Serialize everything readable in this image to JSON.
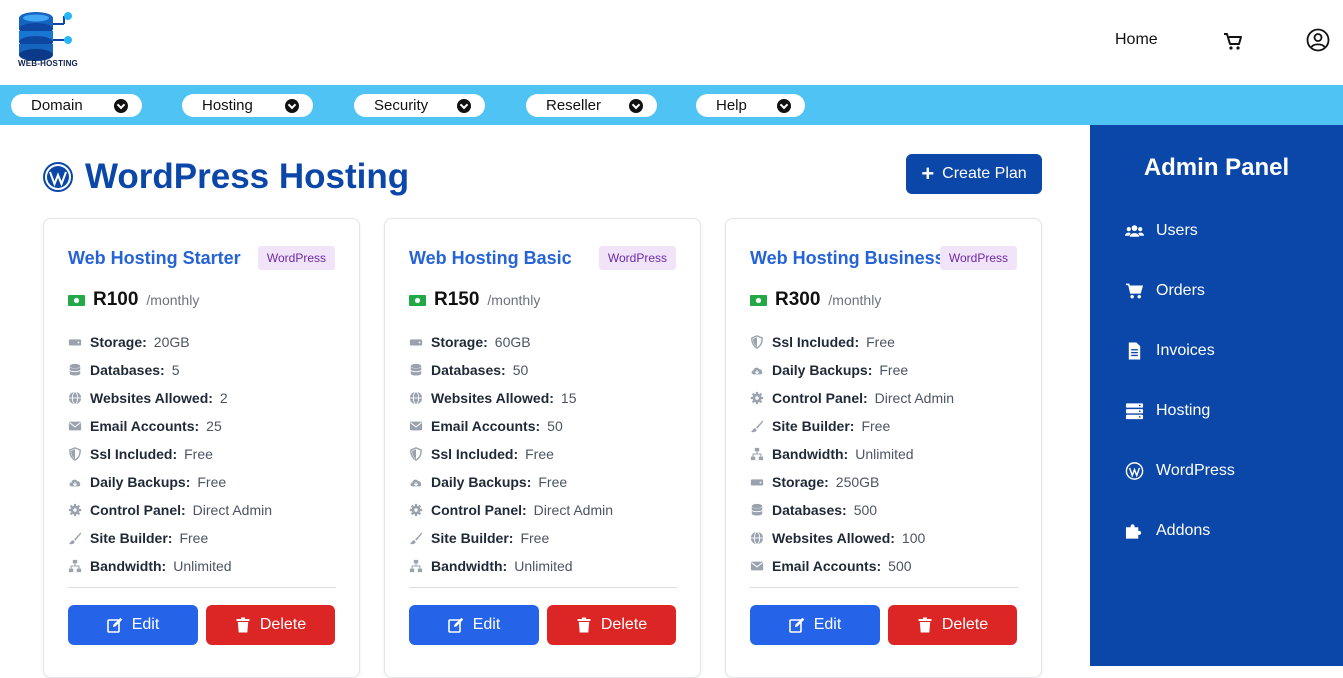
{
  "header": {
    "logo_text": "WEB-HOSTING",
    "home_label": "Home",
    "cart_icon": "cart-icon",
    "user_icon": "user-circle-icon"
  },
  "menu": [
    {
      "label": "Domain"
    },
    {
      "label": "Hosting"
    },
    {
      "label": "Security"
    },
    {
      "label": "Reseller"
    },
    {
      "label": "Help"
    }
  ],
  "main": {
    "title": "WordPress Hosting",
    "create_label": "Create Plan"
  },
  "cards": [
    {
      "title": "Web Hosting Starter",
      "badge": "WordPress",
      "price": "R100",
      "period": "/monthly",
      "features": [
        {
          "icon": "storage",
          "key": "Storage:",
          "value": "20GB"
        },
        {
          "icon": "database",
          "key": "Databases:",
          "value": "5"
        },
        {
          "icon": "globe",
          "key": "Websites Allowed:",
          "value": "2"
        },
        {
          "icon": "mail",
          "key": "Email Accounts:",
          "value": "25"
        },
        {
          "icon": "shield",
          "key": "Ssl Included:",
          "value": "Free"
        },
        {
          "icon": "cloud",
          "key": "Daily Backups:",
          "value": "Free"
        },
        {
          "icon": "gear",
          "key": "Control Panel:",
          "value": "Direct Admin"
        },
        {
          "icon": "brush",
          "key": "Site Builder:",
          "value": "Free"
        },
        {
          "icon": "network",
          "key": "Bandwidth:",
          "value": "Unlimited"
        }
      ],
      "edit_label": "Edit",
      "delete_label": "Delete"
    },
    {
      "title": "Web Hosting Basic",
      "badge": "WordPress",
      "price": "R150",
      "period": "/monthly",
      "features": [
        {
          "icon": "storage",
          "key": "Storage:",
          "value": "60GB"
        },
        {
          "icon": "database",
          "key": "Databases:",
          "value": "50"
        },
        {
          "icon": "globe",
          "key": "Websites Allowed:",
          "value": "15"
        },
        {
          "icon": "mail",
          "key": "Email Accounts:",
          "value": "50"
        },
        {
          "icon": "shield",
          "key": "Ssl Included:",
          "value": "Free"
        },
        {
          "icon": "cloud",
          "key": "Daily Backups:",
          "value": "Free"
        },
        {
          "icon": "gear",
          "key": "Control Panel:",
          "value": "Direct Admin"
        },
        {
          "icon": "brush",
          "key": "Site Builder:",
          "value": "Free"
        },
        {
          "icon": "network",
          "key": "Bandwidth:",
          "value": "Unlimited"
        }
      ],
      "edit_label": "Edit",
      "delete_label": "Delete"
    },
    {
      "title": "Web Hosting Business",
      "badge": "WordPress",
      "price": "R300",
      "period": "/monthly",
      "features": [
        {
          "icon": "shield",
          "key": "Ssl Included:",
          "value": "Free"
        },
        {
          "icon": "cloud",
          "key": "Daily Backups:",
          "value": "Free"
        },
        {
          "icon": "gear",
          "key": "Control Panel:",
          "value": "Direct Admin"
        },
        {
          "icon": "brush",
          "key": "Site Builder:",
          "value": "Free"
        },
        {
          "icon": "network",
          "key": "Bandwidth:",
          "value": "Unlimited"
        },
        {
          "icon": "storage",
          "key": "Storage:",
          "value": "250GB"
        },
        {
          "icon": "database",
          "key": "Databases:",
          "value": "500"
        },
        {
          "icon": "globe",
          "key": "Websites Allowed:",
          "value": "100"
        },
        {
          "icon": "mail",
          "key": "Email Accounts:",
          "value": "500"
        }
      ],
      "edit_label": "Edit",
      "delete_label": "Delete"
    }
  ],
  "sidebar": {
    "title": "Admin Panel",
    "items": [
      {
        "icon": "users",
        "label": "Users"
      },
      {
        "icon": "cart",
        "label": "Orders"
      },
      {
        "icon": "invoice",
        "label": "Invoices"
      },
      {
        "icon": "server",
        "label": "Hosting"
      },
      {
        "icon": "wordpress",
        "label": "WordPress"
      },
      {
        "icon": "puzzle",
        "label": "Addons"
      }
    ]
  },
  "colors": {
    "brand": "#0b47a8",
    "menubar": "#4fc3f3",
    "edit": "#2563e8",
    "delete": "#dc2626",
    "badge_bg": "#f1e4f8",
    "price_icon": "#22a845"
  }
}
